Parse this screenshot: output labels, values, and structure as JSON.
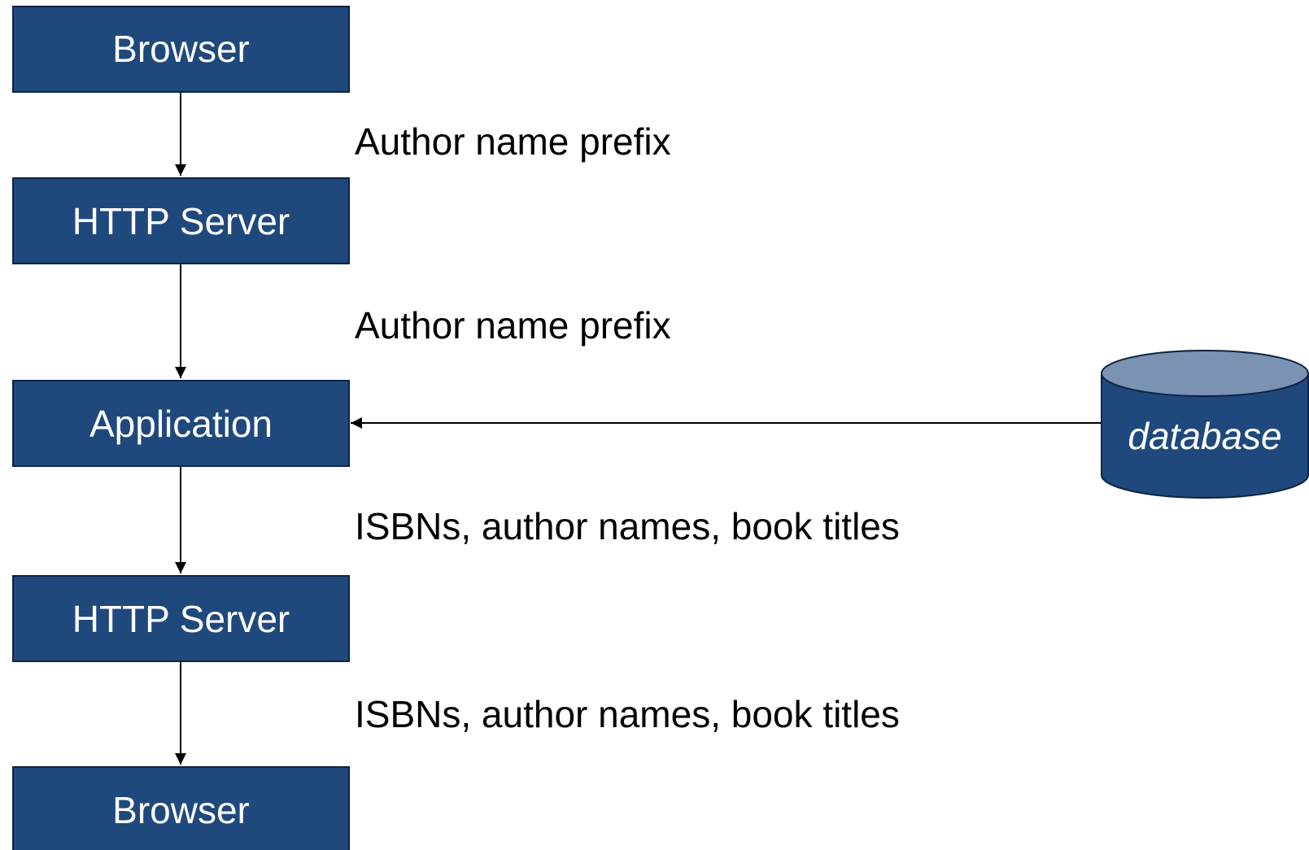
{
  "colors": {
    "box_fill": "#1f497d",
    "box_stroke": "#0d2340",
    "db_top": "#7b93b2",
    "line": "#000000",
    "text_on_box": "#ffffff",
    "text": "#000000"
  },
  "nodes": [
    {
      "id": "browser-top",
      "label": "Browser"
    },
    {
      "id": "http-server-1",
      "label": "HTTP Server"
    },
    {
      "id": "application",
      "label": "Application"
    },
    {
      "id": "http-server-2",
      "label": "HTTP Server"
    },
    {
      "id": "browser-bottom",
      "label": "Browser"
    }
  ],
  "database": {
    "label": "database"
  },
  "edges": [
    {
      "from": "browser-top",
      "to": "http-server-1",
      "label": "Author name prefix"
    },
    {
      "from": "http-server-1",
      "to": "application",
      "label": "Author name prefix"
    },
    {
      "from": "database",
      "to": "application",
      "label": ""
    },
    {
      "from": "application",
      "to": "http-server-2",
      "label": "ISBNs, author names, book titles"
    },
    {
      "from": "http-server-2",
      "to": "browser-bottom",
      "label": "ISBNs, author names, book titles"
    }
  ]
}
